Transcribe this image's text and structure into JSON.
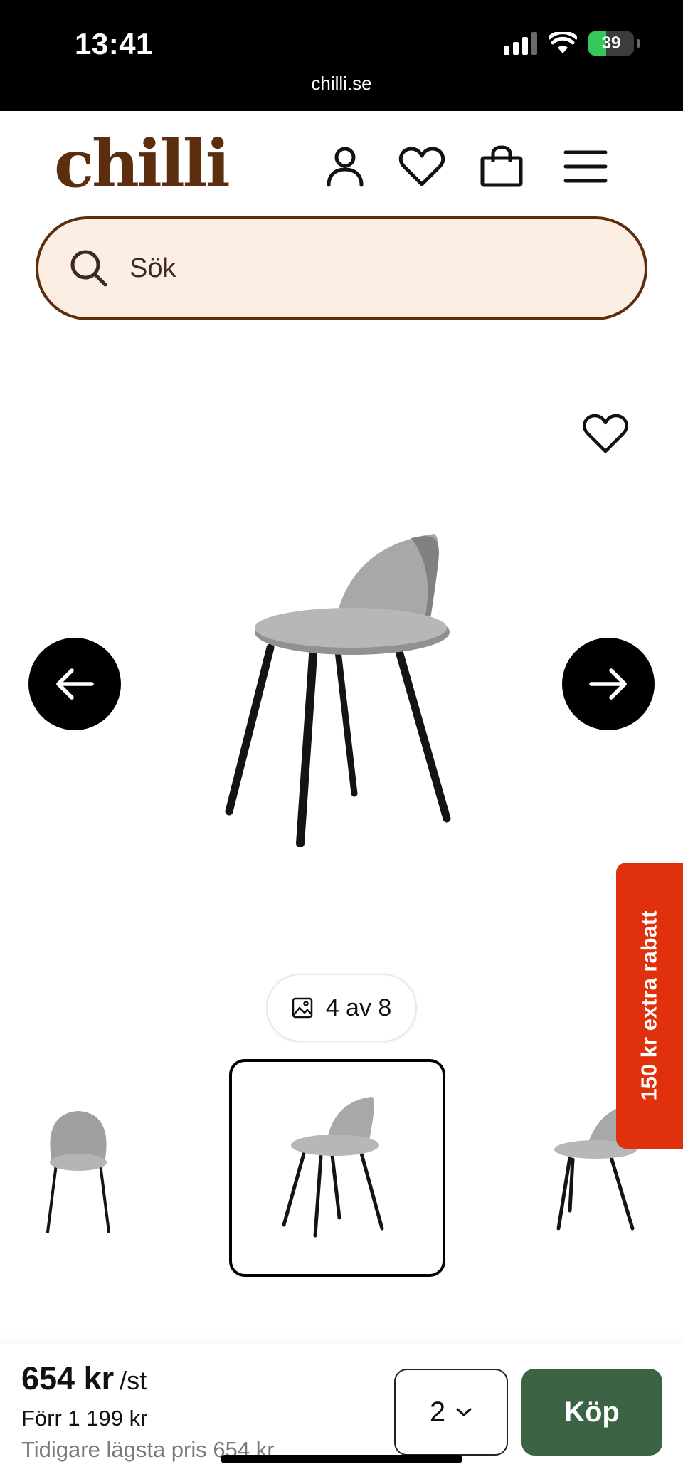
{
  "status": {
    "time": "13:41",
    "battery": "39",
    "battery_level": 0.39,
    "url": "chilli.se"
  },
  "header": {
    "logo": "chilli",
    "icons": [
      "account-icon",
      "heart-icon",
      "bag-icon",
      "menu-icon"
    ]
  },
  "search": {
    "placeholder": "Sök"
  },
  "gallery": {
    "counter": "4 av 8",
    "current": 4,
    "total": 8
  },
  "promo": {
    "label": "150 kr extra rabatt"
  },
  "purchase": {
    "price": "654 kr",
    "unit": "/st",
    "before": "Förr 1 199 kr",
    "lowest": "Tidigare lägsta pris 654 kr",
    "quantity": "2",
    "buy_label": "Köp"
  },
  "colors": {
    "brand": "#5c2e0e",
    "search_bg": "#fdeee3",
    "promo": "#e0300c",
    "buy": "#3c6343"
  }
}
